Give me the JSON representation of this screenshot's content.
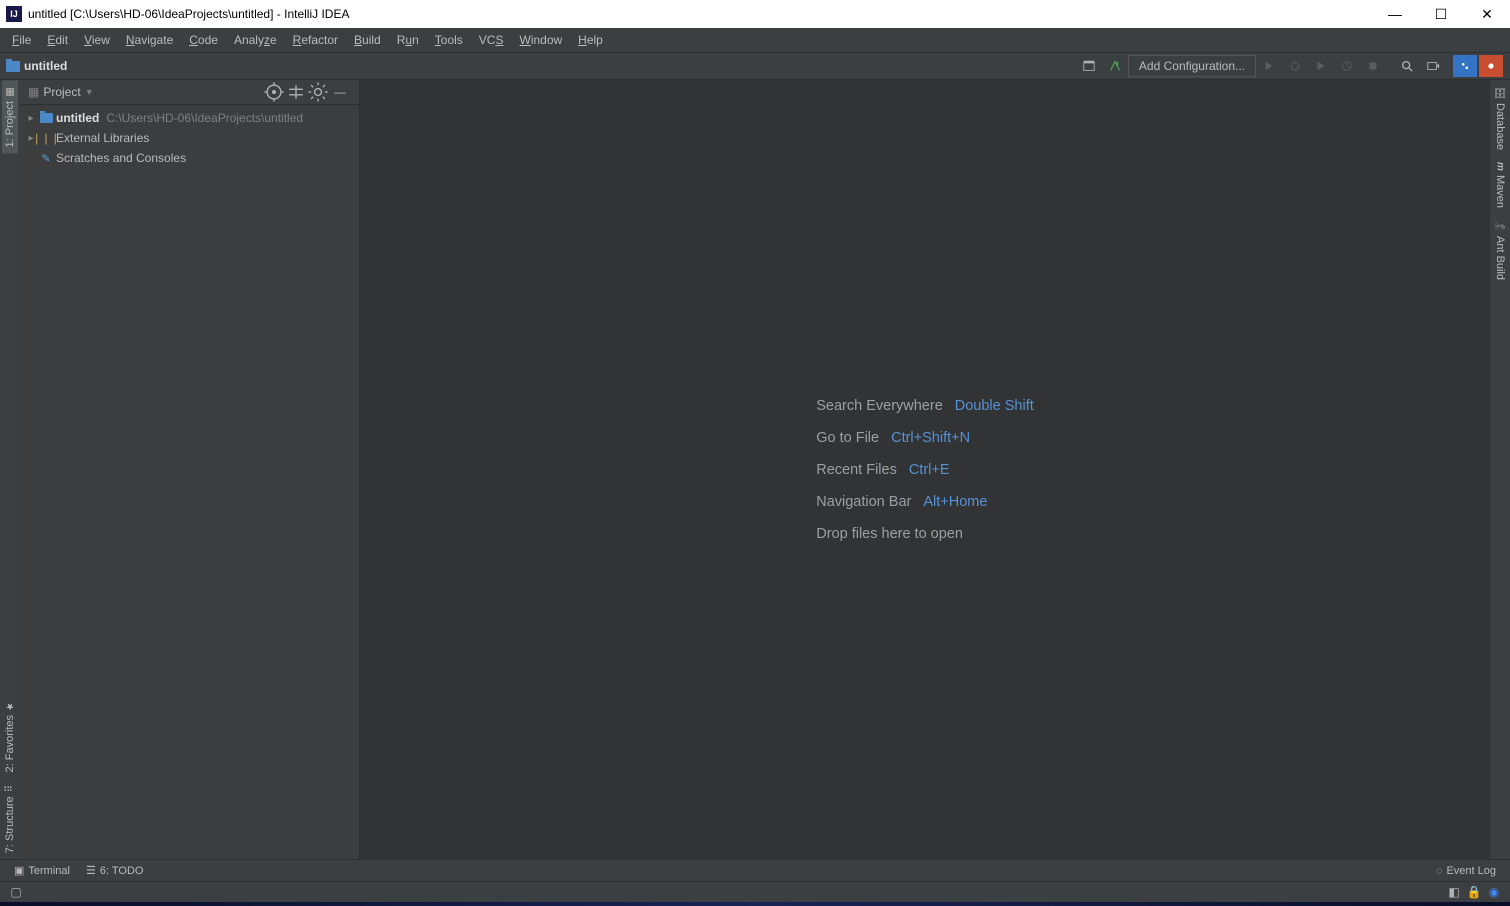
{
  "titlebar": {
    "title": "untitled [C:\\Users\\HD-06\\IdeaProjects\\untitled] - IntelliJ IDEA"
  },
  "menu": {
    "file": "File",
    "edit": "Edit",
    "view": "View",
    "navigate": "Navigate",
    "code": "Code",
    "analyze": "Analyze",
    "refactor": "Refactor",
    "build": "Build",
    "run": "Run",
    "tools": "Tools",
    "vcs": "VCS",
    "window": "Window",
    "help": "Help"
  },
  "navbar": {
    "crumb": "untitled",
    "add_config": "Add Configuration..."
  },
  "project_panel": {
    "title": "Project",
    "tree": {
      "root_name": "untitled",
      "root_path": "C:\\Users\\HD-06\\IdeaProjects\\untitled",
      "external_libs": "External Libraries",
      "scratches": "Scratches and Consoles"
    }
  },
  "left_tabs": {
    "project": "1: Project",
    "favorites": "2: Favorites",
    "structure": "7: Structure"
  },
  "right_tabs": {
    "database": "Database",
    "maven": "Maven",
    "ant": "Ant Build"
  },
  "editor_hints": {
    "search_label": "Search Everywhere",
    "search_key": "Double Shift",
    "goto_label": "Go to File",
    "goto_key": "Ctrl+Shift+N",
    "recent_label": "Recent Files",
    "recent_key": "Ctrl+E",
    "nav_label": "Navigation Bar",
    "nav_key": "Alt+Home",
    "drop": "Drop files here to open"
  },
  "bottom_tabs": {
    "terminal": "Terminal",
    "todo": "6: TODO",
    "event_log": "Event Log"
  }
}
